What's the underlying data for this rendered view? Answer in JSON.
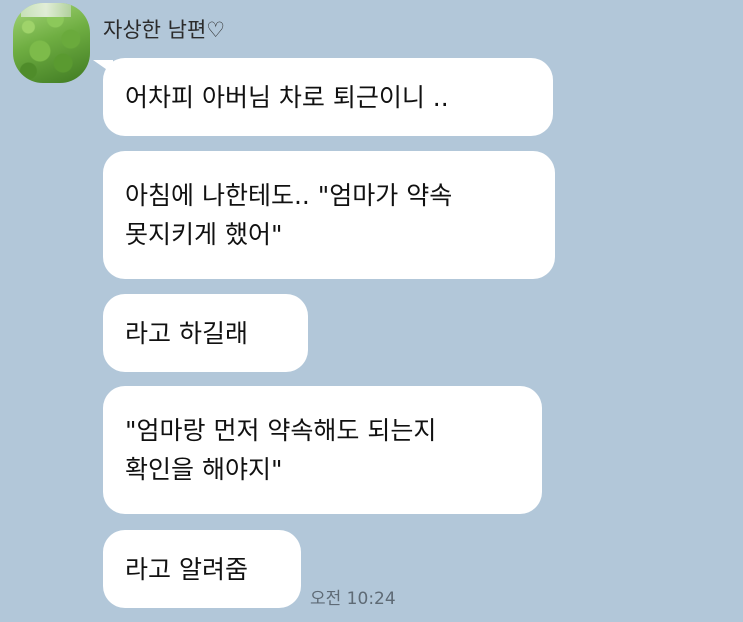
{
  "chat": {
    "sender_name": "자상한 남편♡",
    "messages": [
      {
        "lines": [
          "어차피 아버님 차로 퇴근이니 .."
        ]
      },
      {
        "lines": [
          "아침에 나한테도.. \"엄마가 약속",
          "못지키게 했어\""
        ]
      },
      {
        "lines": [
          "라고 하길래"
        ]
      },
      {
        "lines": [
          "\"엄마랑 먼저 약속해도 되는지",
          "확인을 해야지\""
        ]
      },
      {
        "lines": [
          "라고 알려줌"
        ]
      }
    ],
    "timestamp": "오전 10:24"
  },
  "colors": {
    "background": "#b2c7d9",
    "bubble": "#ffffff",
    "text": "#111111",
    "timestamp": "#5e6a75"
  }
}
